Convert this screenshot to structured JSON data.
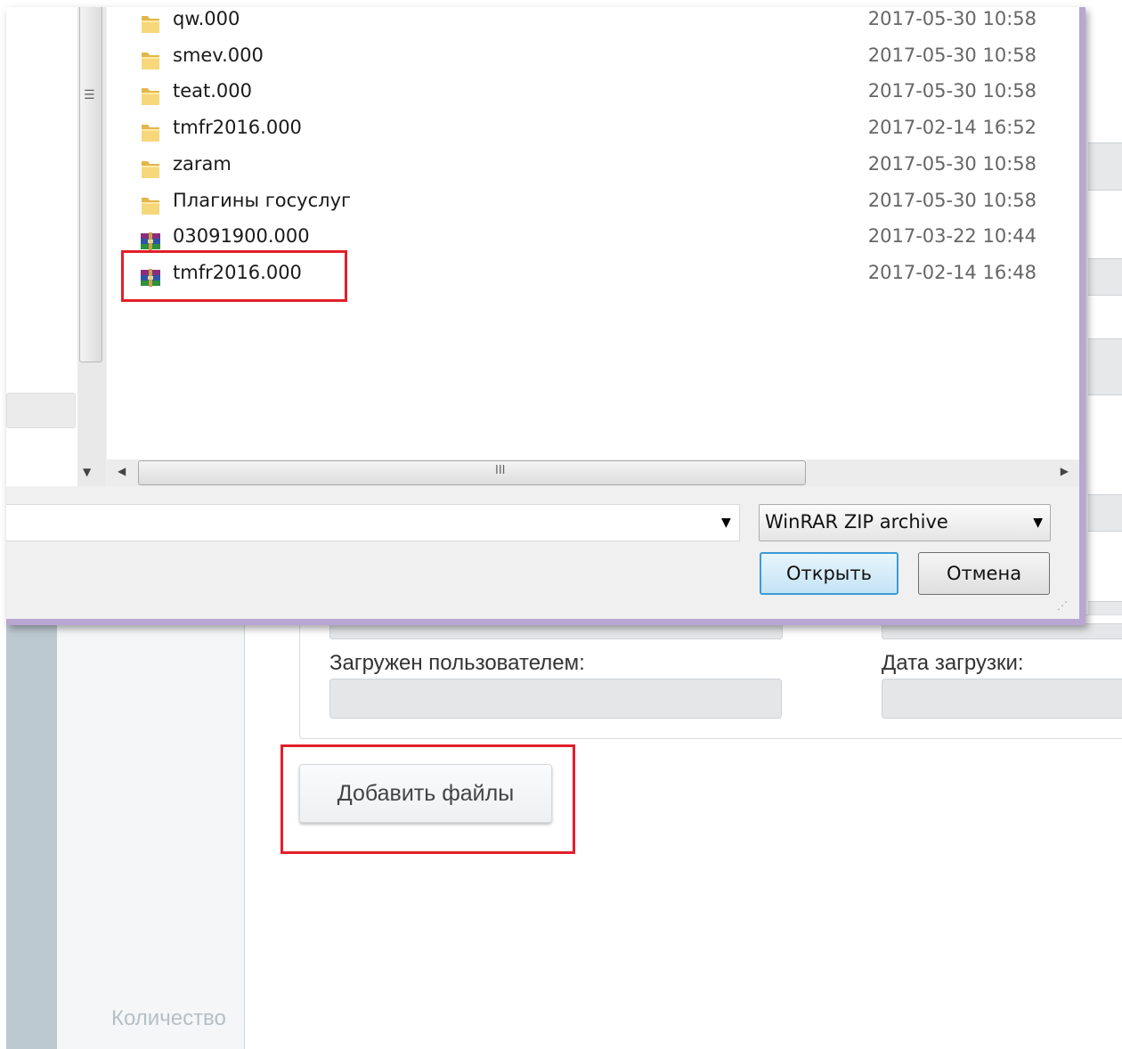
{
  "dialog": {
    "files": [
      {
        "name": "qw.000",
        "date": "2017-05-30 10:58",
        "icon": "folder-icon"
      },
      {
        "name": "smev.000",
        "date": "2017-05-30 10:58",
        "icon": "folder-icon"
      },
      {
        "name": "teat.000",
        "date": "2017-05-30 10:58",
        "icon": "folder-icon"
      },
      {
        "name": "tmfr2016.000",
        "date": "2017-02-14 16:52",
        "icon": "folder-icon"
      },
      {
        "name": "zaram",
        "date": "2017-05-30 10:58",
        "icon": "folder-icon"
      },
      {
        "name": "Плагины госуслуг",
        "date": "2017-05-30 10:58",
        "icon": "folder-icon"
      },
      {
        "name": "03091900.000",
        "date": "2017-03-22 10:44",
        "icon": "winrar-archive-icon"
      },
      {
        "name": "tmfr2016.000",
        "date": "2017-02-14 16:48",
        "icon": "winrar-archive-icon"
      }
    ],
    "file_name_value": "",
    "file_type": "WinRAR ZIP archive",
    "open_label": "Открыть",
    "cancel_label": "Отмена"
  },
  "page": {
    "uploaded_by_label": "Загружен пользователем:",
    "upload_date_label": "Дата загрузки:",
    "add_files_label": "Добавить файлы",
    "quantity_label": "Количество"
  },
  "colors": {
    "highlight": "#e21f2a",
    "dialog_border": "#b9a6d3",
    "open_button_border": "#3c9bd6"
  }
}
